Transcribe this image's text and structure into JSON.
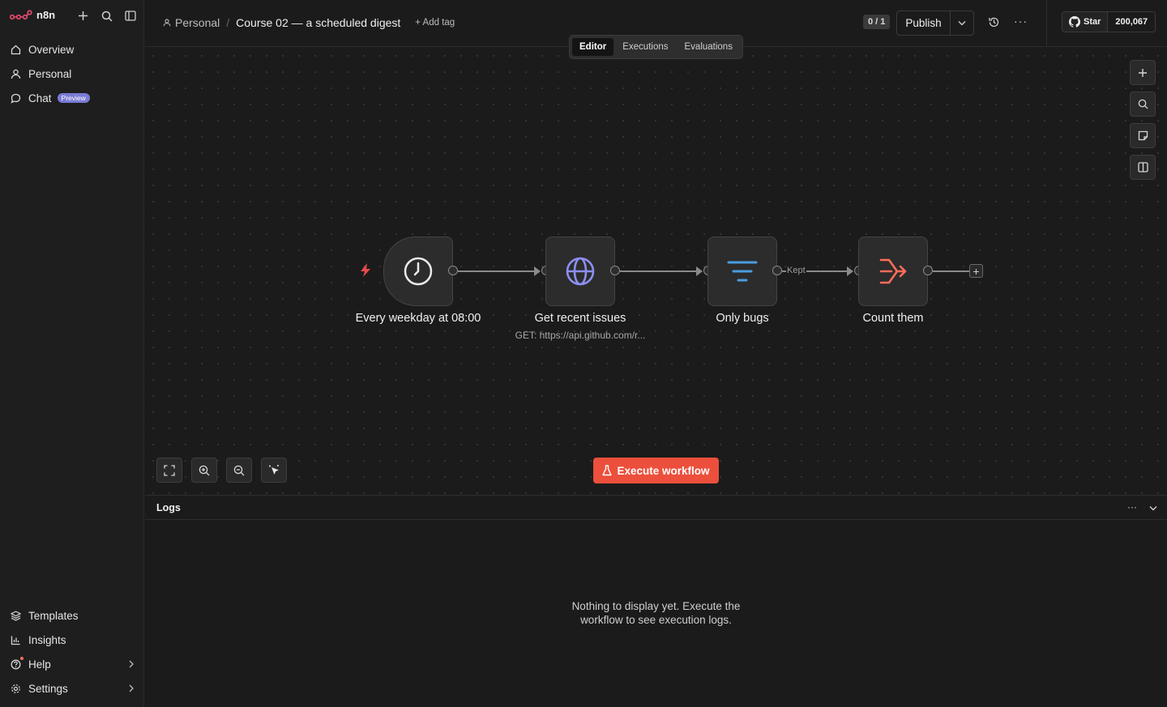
{
  "app": {
    "name": "n8n"
  },
  "sidebar": {
    "nav": [
      {
        "label": "Overview",
        "icon": "home-icon"
      },
      {
        "label": "Personal",
        "icon": "user-icon"
      },
      {
        "label": "Chat",
        "icon": "chat-icon",
        "badge": "Preview"
      }
    ],
    "bottom": [
      {
        "label": "Templates",
        "icon": "templates-icon"
      },
      {
        "label": "Insights",
        "icon": "insights-icon"
      },
      {
        "label": "Help",
        "icon": "help-icon"
      },
      {
        "label": "Settings",
        "icon": "settings-icon"
      }
    ]
  },
  "header": {
    "breadcrumb_project": "Personal",
    "separator": "/",
    "workflow_title": "Course 02 — a scheduled digest",
    "add_tag": "+ Add tag",
    "counter": "0 / 1",
    "publish_label": "Publish",
    "more": "···",
    "github_star": "Star",
    "github_count": "200,067"
  },
  "tabs": [
    {
      "label": "Editor",
      "active": true
    },
    {
      "label": "Executions",
      "active": false
    },
    {
      "label": "Evaluations",
      "active": false
    }
  ],
  "nodes": [
    {
      "name": "Every weekday at 08:00",
      "subtitle": "",
      "icon": "clock-icon",
      "trigger": true
    },
    {
      "name": "Get recent issues",
      "subtitle": "GET: https://api.github.com/r...",
      "icon": "globe-icon",
      "trigger": false
    },
    {
      "name": "Only bugs",
      "subtitle": "",
      "icon": "filter-icon",
      "trigger": false
    },
    {
      "name": "Count them",
      "subtitle": "",
      "icon": "summarize-icon",
      "trigger": false
    }
  ],
  "connections": [
    {
      "from": "Every weekday at 08:00",
      "to": "Get recent issues",
      "label": ""
    },
    {
      "from": "Get recent issues",
      "to": "Only bugs",
      "label": ""
    },
    {
      "from": "Only bugs",
      "to": "Count them",
      "label": "Kept"
    }
  ],
  "canvas": {
    "execute_label": "Execute workflow",
    "add_node_end": "+"
  },
  "logs": {
    "title": "Logs",
    "empty_line1": "Nothing to display yet. Execute the",
    "empty_line2": "workflow to see execution logs.",
    "more": "···"
  },
  "colors": {
    "accent": "#ec4f3b",
    "background": "#1b1b1b",
    "node_bg": "#2c2c2c",
    "globe": "#8c8ff0",
    "filter": "#4a9de0",
    "summarize": "#ff6d5a"
  }
}
